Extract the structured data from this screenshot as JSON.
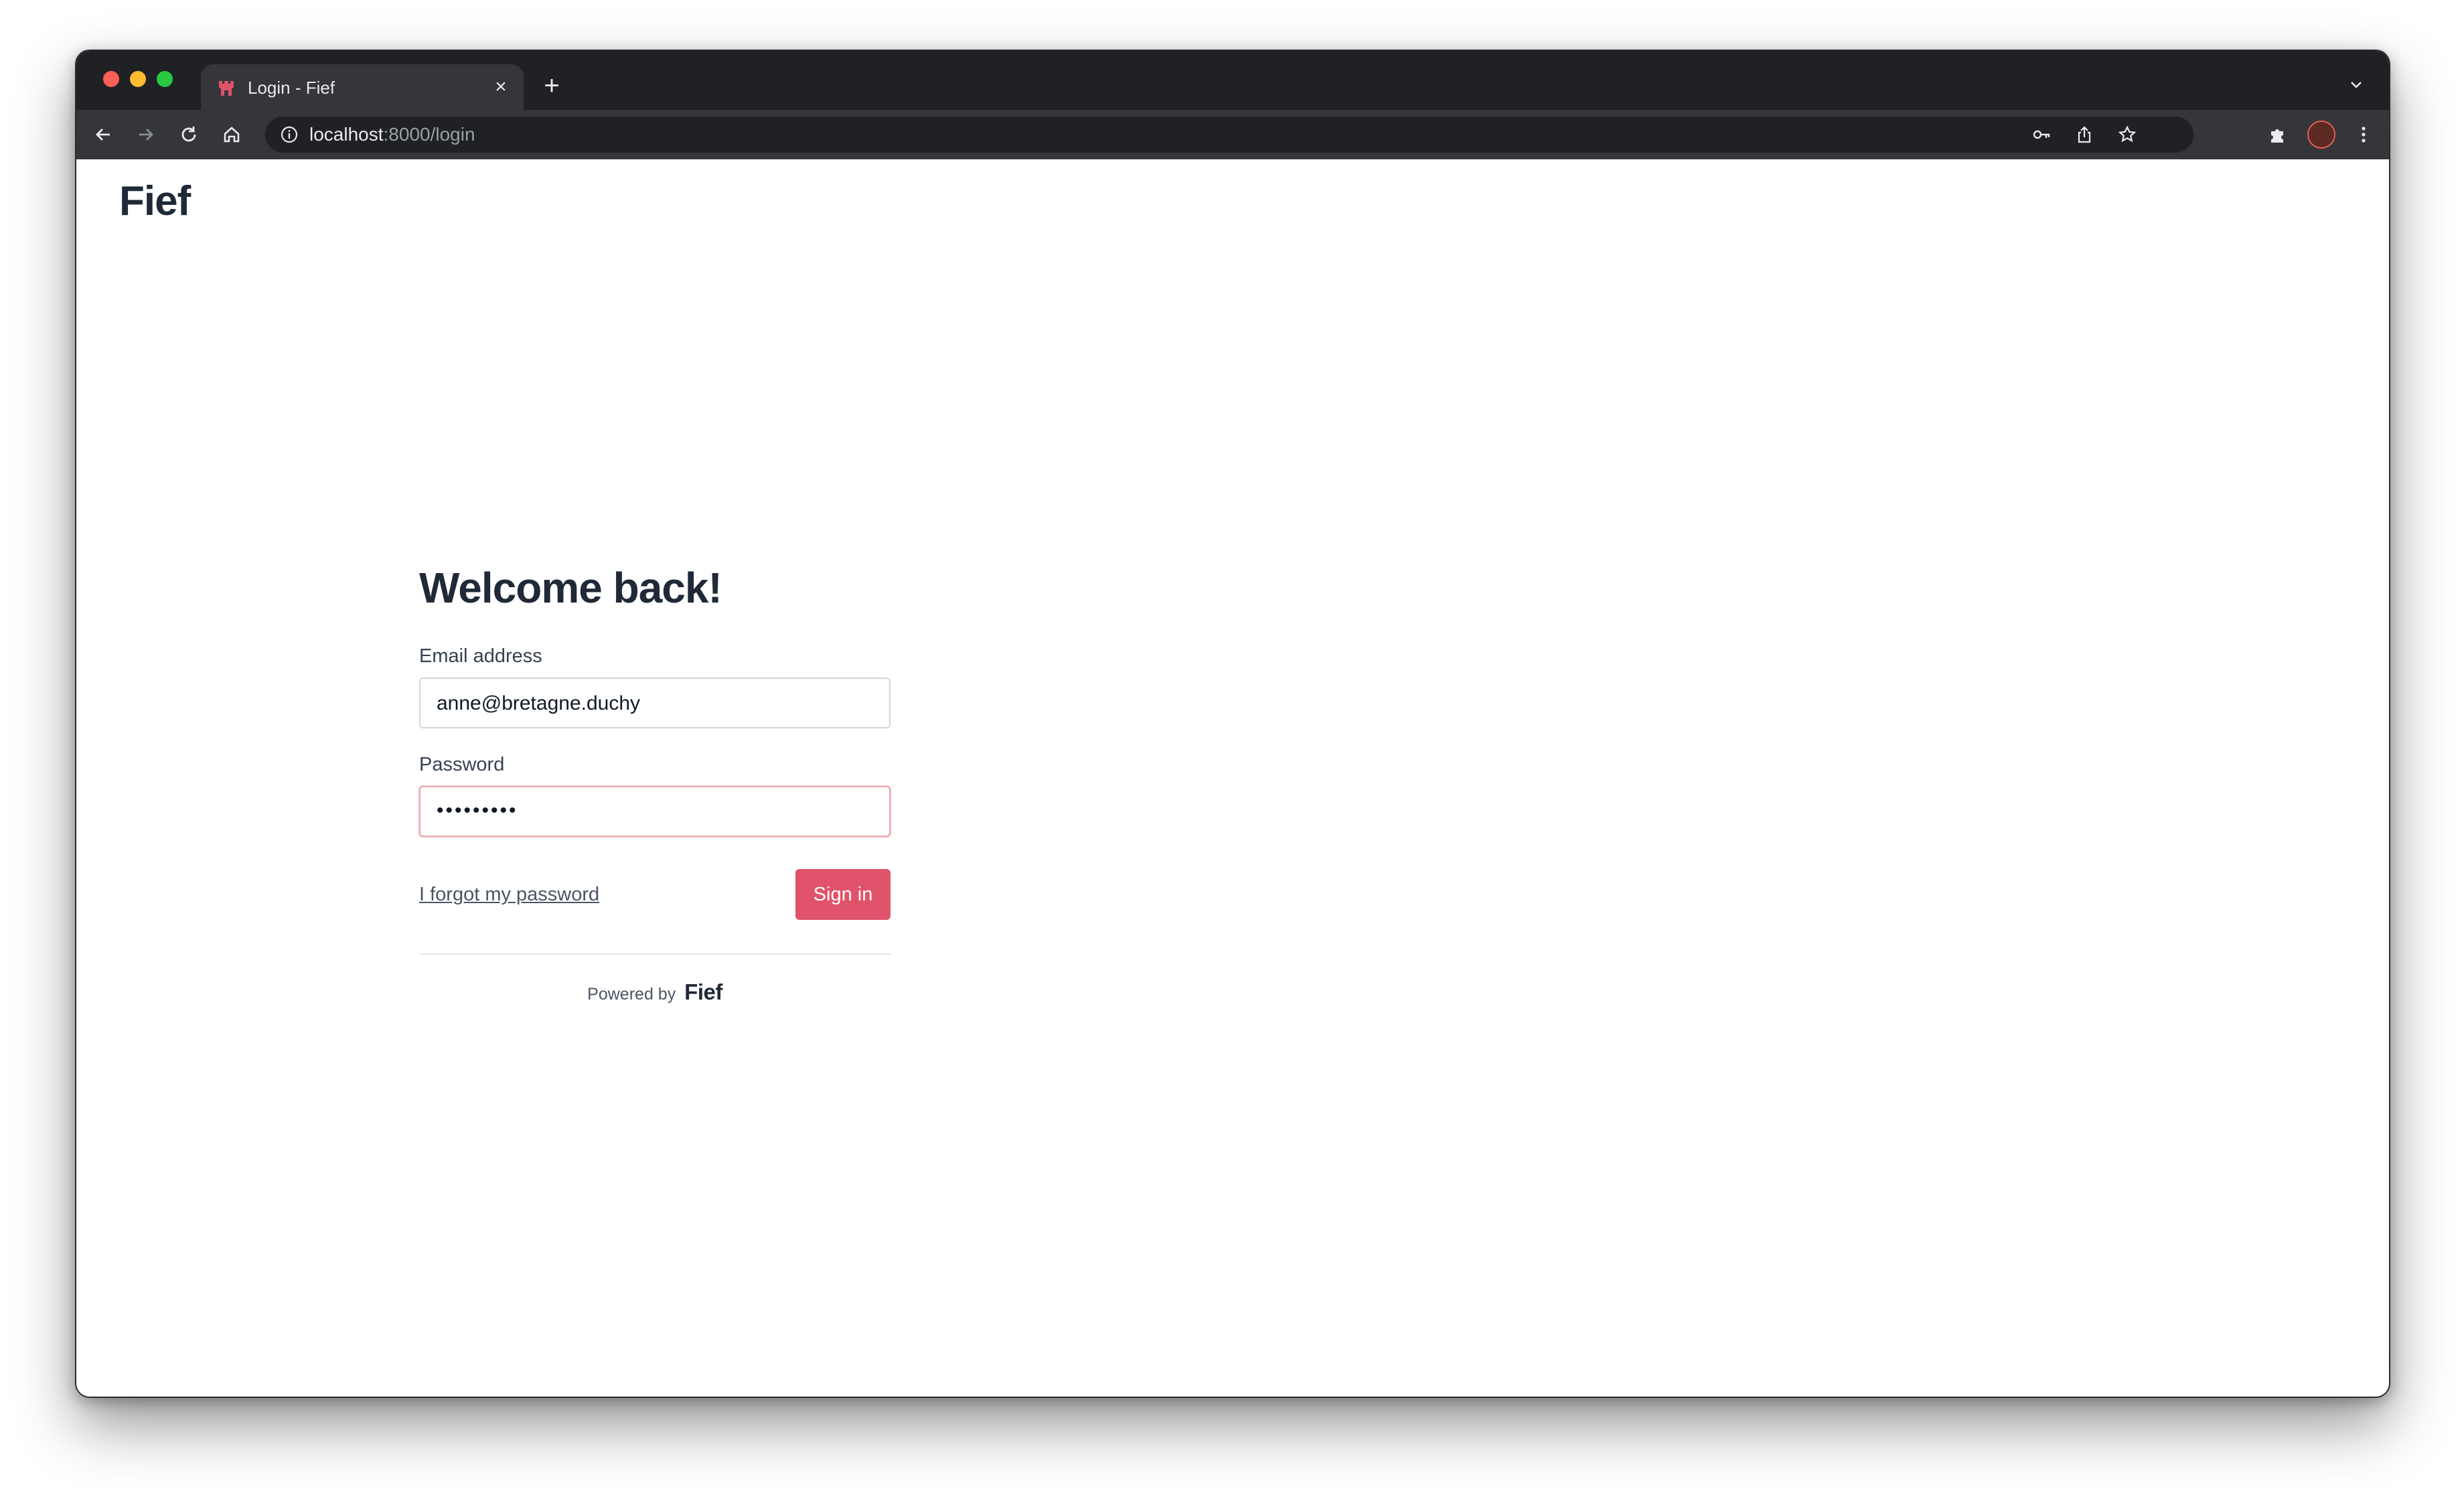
{
  "browser": {
    "tab_title": "Login - Fief",
    "url_host": "localhost",
    "url_path": ":8000/login",
    "icons": [
      "back-arrow-icon",
      "forward-arrow-icon",
      "reload-icon",
      "home-icon",
      "info-icon",
      "key-icon",
      "share-icon",
      "star-icon",
      "puzzle-icon",
      "kebab-menu-icon"
    ]
  },
  "page": {
    "brand": "Fief",
    "heading": "Welcome back!",
    "email_label": "Email address",
    "email_value": "anne@bretagne.duchy",
    "password_label": "Password",
    "password_value": "•••••••••",
    "forgot_link": "I forgot my password",
    "signin_label": "Sign in",
    "powered_by": "Powered by",
    "powered_brand": "Fief"
  },
  "colors": {
    "accent": "#e0536a",
    "text": "#1f2937",
    "chrome_dark": "#202124",
    "chrome_toolbar": "#35363a"
  }
}
